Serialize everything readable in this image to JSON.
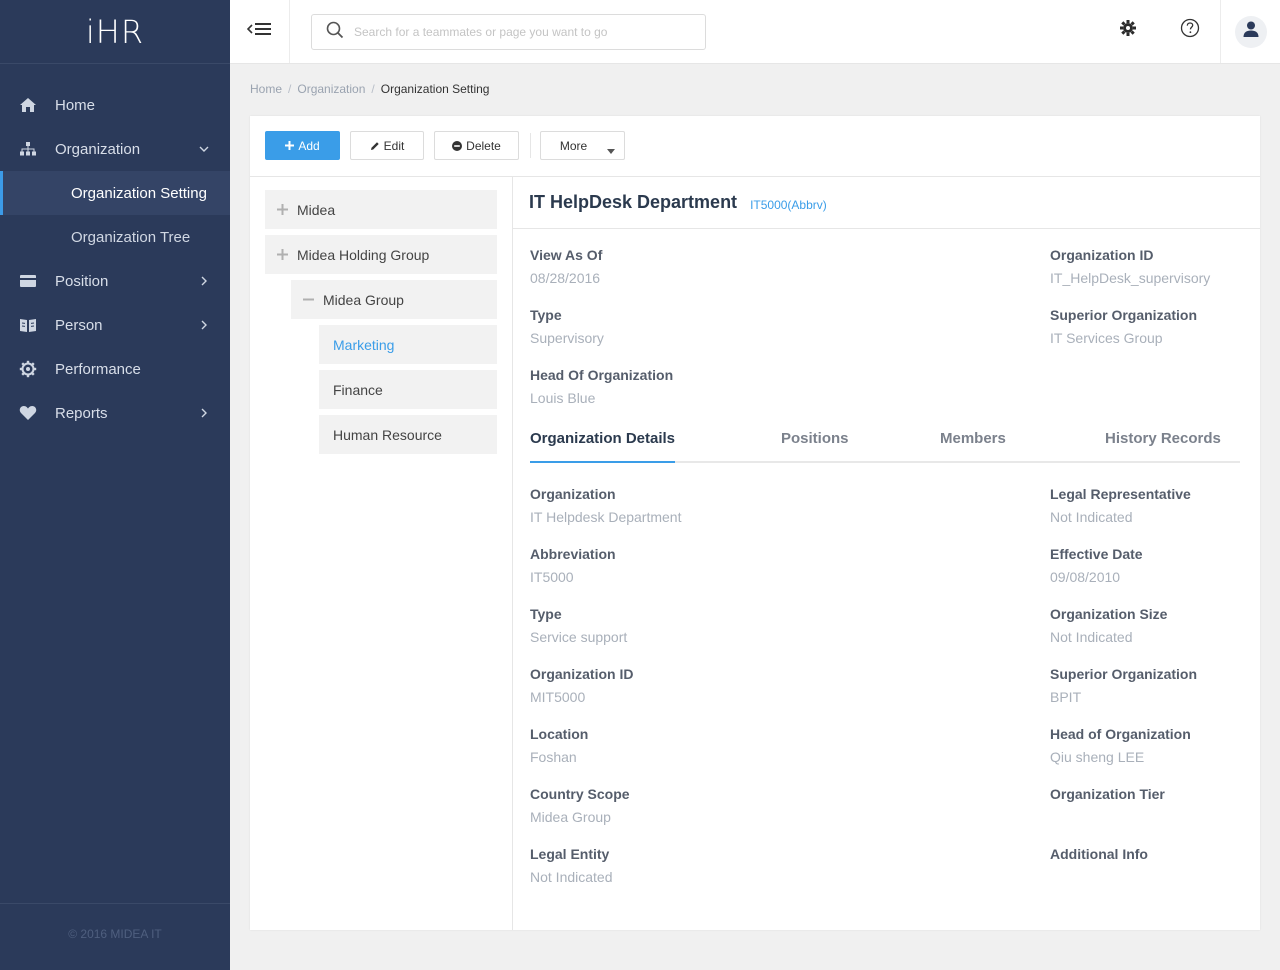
{
  "app": {
    "logo": "iHR",
    "copyright": "© 2016 MIDEA IT"
  },
  "sidebar": {
    "items": [
      {
        "label": "Home",
        "icon": "home-icon"
      },
      {
        "label": "Organization",
        "icon": "org-chart-icon",
        "expanded": true,
        "children": [
          {
            "label": "Organization Setting",
            "active": true
          },
          {
            "label": "Organization Tree"
          }
        ]
      },
      {
        "label": "Position",
        "icon": "card-icon"
      },
      {
        "label": "Person",
        "icon": "book-icon"
      },
      {
        "label": "Performance",
        "icon": "gear-icon"
      },
      {
        "label": "Reports",
        "icon": "heart-icon"
      }
    ]
  },
  "header": {
    "search_placeholder": "Search for a teammates or page you want to go"
  },
  "breadcrumb": {
    "items": [
      "Home",
      "Organization",
      "Organization Setting"
    ],
    "separator": "/"
  },
  "toolbar": {
    "add": "Add",
    "edit": "Edit",
    "delete": "Delete",
    "more": "More"
  },
  "tree": {
    "nodes": [
      {
        "label": "Midea",
        "state": "collapsed"
      },
      {
        "label": "Midea Holding Group",
        "state": "collapsed"
      },
      {
        "label": "Midea Group",
        "state": "expanded"
      },
      {
        "label": "Marketing",
        "selected": true
      },
      {
        "label": "Finance"
      },
      {
        "label": "Human Resource"
      }
    ]
  },
  "detail": {
    "title": "IT HelpDesk Department",
    "abbr": "IT5000(Abbrv)",
    "summary": {
      "view_as_of": {
        "label": "View As Of",
        "value": "08/28/2016"
      },
      "org_id": {
        "label": "Organization ID",
        "value": "IT_HelpDesk_supervisory"
      },
      "type": {
        "label": "Type",
        "value": "Supervisory"
      },
      "superior": {
        "label": "Superior Organization",
        "value": "IT Services Group"
      },
      "head": {
        "label": "Head Of Organization",
        "value": "Louis Blue"
      }
    },
    "tabs": [
      "Organization Details",
      "Positions",
      "Members",
      "History Records"
    ],
    "active_tab": 0,
    "left_fields": [
      {
        "label": "Organization",
        "value": "IT Helpdesk Department"
      },
      {
        "label": "Abbreviation",
        "value": "IT5000"
      },
      {
        "label": "Type",
        "value": "Service support"
      },
      {
        "label": "Organization ID",
        "value": "MIT5000"
      },
      {
        "label": "Location",
        "value": "Foshan"
      },
      {
        "label": "Country Scope",
        "value": "Midea Group"
      },
      {
        "label": "Legal Entity",
        "value": "Not Indicated"
      }
    ],
    "right_fields": [
      {
        "label": "Legal Representative",
        "value": "Not Indicated"
      },
      {
        "label": "Effective Date",
        "value": "09/08/2010"
      },
      {
        "label": "Organization Size",
        "value": "Not Indicated"
      },
      {
        "label": "Superior Organization",
        "value": "BPIT"
      },
      {
        "label": "Head of Organization",
        "value": "Qiu sheng LEE"
      },
      {
        "label": "Organization Tier",
        "value": ""
      },
      {
        "label": "Additional Info",
        "value": ""
      }
    ]
  },
  "colors": {
    "sidebar_bg": "#2b3a5a",
    "accent": "#3a9de8",
    "label": "#555d6b",
    "value": "#a9b0ba"
  }
}
